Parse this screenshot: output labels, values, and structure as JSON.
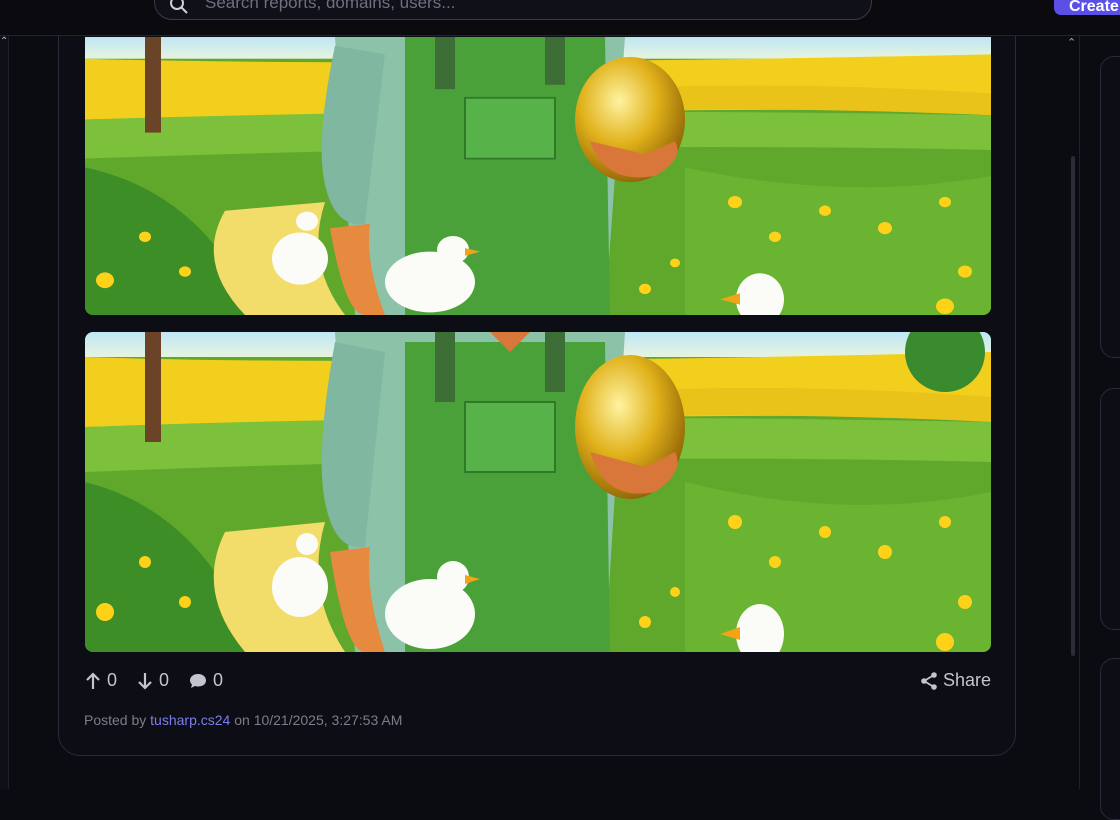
{
  "header": {
    "search_placeholder": "Search reports, domains, users...",
    "create_label": "Create"
  },
  "post": {
    "upvotes": "0",
    "downvotes": "0",
    "comments": "0",
    "share_label": "Share",
    "posted_by_prefix": "Posted by",
    "author": "tusharp.cs24",
    "posted_on_prefix": "on",
    "timestamp": "10/21/2025, 3:27:53 AM"
  },
  "icons": {
    "search": "search-icon",
    "upvote": "arrow-up-icon",
    "downvote": "arrow-down-icon",
    "comment": "comment-icon",
    "share": "share-icon"
  },
  "colors": {
    "accent": "#5b50e6",
    "link": "#7b7ef0",
    "background": "#0b0b12"
  }
}
